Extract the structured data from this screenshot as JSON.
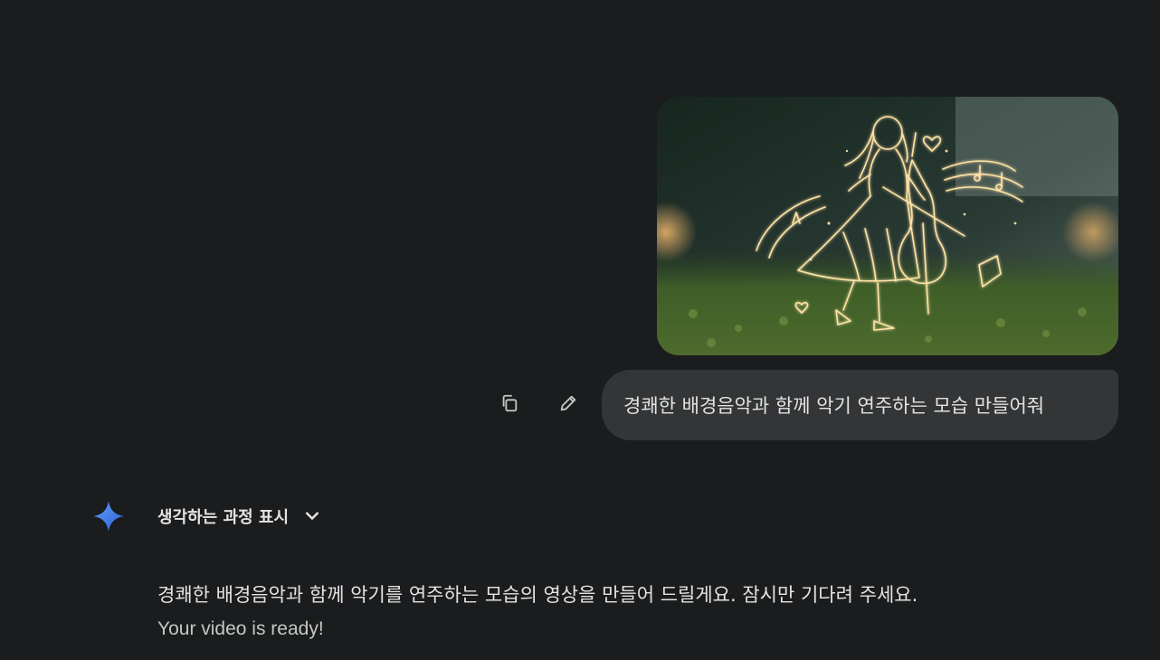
{
  "conversation": {
    "user_message": {
      "attachment_icon": "image-thumbnail",
      "prompt_text": "경쾌한 배경음악과 함께 악기 연주하는 모습 만들어줘",
      "copy_icon": "copy-icon",
      "edit_icon": "pencil-icon"
    },
    "model_response": {
      "avatar_icon": "gemini-sparkle-icon",
      "thinking_label": "생각하는 과정 표시",
      "thinking_toggle_icon": "chevron-down-icon",
      "body_text": "경쾌한 배경음악과 함께 악기를 연주하는 모습의 영상을 만들어 드릴게요. 잠시만 기다려 주세요.",
      "status_text": "Your video is ready!"
    }
  },
  "colors": {
    "background": "#1b1c1e",
    "bubble": "#333537",
    "text": "#e3e3e3",
    "muted_text": "#c4c7c5",
    "icon": "#c4c7c5",
    "sparkle_start": "#4a90f7",
    "sparkle_end": "#3b6fe0",
    "glow": "#ffd98a"
  }
}
